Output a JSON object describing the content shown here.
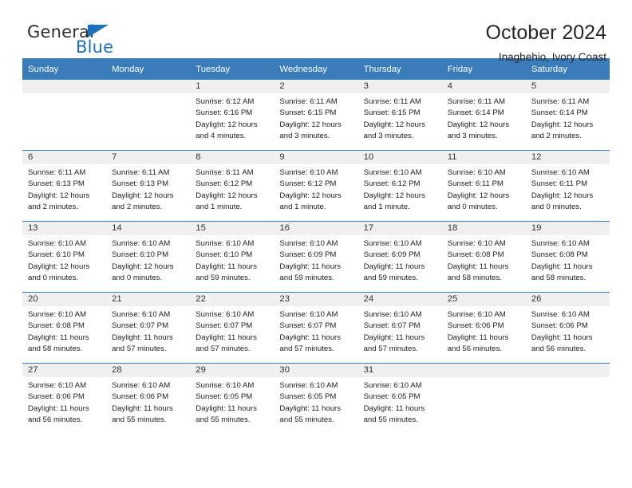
{
  "brand": {
    "name_part1": "General",
    "name_part2": "Blue",
    "logo_icon": "triangle-icon"
  },
  "header": {
    "title": "October 2024",
    "subtitle": "Inagbehio, Ivory Coast"
  },
  "calendar": {
    "weekday_headers": [
      "Sunday",
      "Monday",
      "Tuesday",
      "Wednesday",
      "Thursday",
      "Friday",
      "Saturday"
    ],
    "accent_color": "#3a7cb9",
    "daynum_bg": "#f0f0f0",
    "weeks": [
      [
        {
          "day": "",
          "lines": []
        },
        {
          "day": "",
          "lines": []
        },
        {
          "day": "1",
          "lines": [
            "Sunrise: 6:12 AM",
            "Sunset: 6:16 PM",
            "Daylight: 12 hours",
            "and 4 minutes."
          ]
        },
        {
          "day": "2",
          "lines": [
            "Sunrise: 6:11 AM",
            "Sunset: 6:15 PM",
            "Daylight: 12 hours",
            "and 3 minutes."
          ]
        },
        {
          "day": "3",
          "lines": [
            "Sunrise: 6:11 AM",
            "Sunset: 6:15 PM",
            "Daylight: 12 hours",
            "and 3 minutes."
          ]
        },
        {
          "day": "4",
          "lines": [
            "Sunrise: 6:11 AM",
            "Sunset: 6:14 PM",
            "Daylight: 12 hours",
            "and 3 minutes."
          ]
        },
        {
          "day": "5",
          "lines": [
            "Sunrise: 6:11 AM",
            "Sunset: 6:14 PM",
            "Daylight: 12 hours",
            "and 2 minutes."
          ]
        }
      ],
      [
        {
          "day": "6",
          "lines": [
            "Sunrise: 6:11 AM",
            "Sunset: 6:13 PM",
            "Daylight: 12 hours",
            "and 2 minutes."
          ]
        },
        {
          "day": "7",
          "lines": [
            "Sunrise: 6:11 AM",
            "Sunset: 6:13 PM",
            "Daylight: 12 hours",
            "and 2 minutes."
          ]
        },
        {
          "day": "8",
          "lines": [
            "Sunrise: 6:11 AM",
            "Sunset: 6:12 PM",
            "Daylight: 12 hours",
            "and 1 minute."
          ]
        },
        {
          "day": "9",
          "lines": [
            "Sunrise: 6:10 AM",
            "Sunset: 6:12 PM",
            "Daylight: 12 hours",
            "and 1 minute."
          ]
        },
        {
          "day": "10",
          "lines": [
            "Sunrise: 6:10 AM",
            "Sunset: 6:12 PM",
            "Daylight: 12 hours",
            "and 1 minute."
          ]
        },
        {
          "day": "11",
          "lines": [
            "Sunrise: 6:10 AM",
            "Sunset: 6:11 PM",
            "Daylight: 12 hours",
            "and 0 minutes."
          ]
        },
        {
          "day": "12",
          "lines": [
            "Sunrise: 6:10 AM",
            "Sunset: 6:11 PM",
            "Daylight: 12 hours",
            "and 0 minutes."
          ]
        }
      ],
      [
        {
          "day": "13",
          "lines": [
            "Sunrise: 6:10 AM",
            "Sunset: 6:10 PM",
            "Daylight: 12 hours",
            "and 0 minutes."
          ]
        },
        {
          "day": "14",
          "lines": [
            "Sunrise: 6:10 AM",
            "Sunset: 6:10 PM",
            "Daylight: 12 hours",
            "and 0 minutes."
          ]
        },
        {
          "day": "15",
          "lines": [
            "Sunrise: 6:10 AM",
            "Sunset: 6:10 PM",
            "Daylight: 11 hours",
            "and 59 minutes."
          ]
        },
        {
          "day": "16",
          "lines": [
            "Sunrise: 6:10 AM",
            "Sunset: 6:09 PM",
            "Daylight: 11 hours",
            "and 59 minutes."
          ]
        },
        {
          "day": "17",
          "lines": [
            "Sunrise: 6:10 AM",
            "Sunset: 6:09 PM",
            "Daylight: 11 hours",
            "and 59 minutes."
          ]
        },
        {
          "day": "18",
          "lines": [
            "Sunrise: 6:10 AM",
            "Sunset: 6:08 PM",
            "Daylight: 11 hours",
            "and 58 minutes."
          ]
        },
        {
          "day": "19",
          "lines": [
            "Sunrise: 6:10 AM",
            "Sunset: 6:08 PM",
            "Daylight: 11 hours",
            "and 58 minutes."
          ]
        }
      ],
      [
        {
          "day": "20",
          "lines": [
            "Sunrise: 6:10 AM",
            "Sunset: 6:08 PM",
            "Daylight: 11 hours",
            "and 58 minutes."
          ]
        },
        {
          "day": "21",
          "lines": [
            "Sunrise: 6:10 AM",
            "Sunset: 6:07 PM",
            "Daylight: 11 hours",
            "and 57 minutes."
          ]
        },
        {
          "day": "22",
          "lines": [
            "Sunrise: 6:10 AM",
            "Sunset: 6:07 PM",
            "Daylight: 11 hours",
            "and 57 minutes."
          ]
        },
        {
          "day": "23",
          "lines": [
            "Sunrise: 6:10 AM",
            "Sunset: 6:07 PM",
            "Daylight: 11 hours",
            "and 57 minutes."
          ]
        },
        {
          "day": "24",
          "lines": [
            "Sunrise: 6:10 AM",
            "Sunset: 6:07 PM",
            "Daylight: 11 hours",
            "and 57 minutes."
          ]
        },
        {
          "day": "25",
          "lines": [
            "Sunrise: 6:10 AM",
            "Sunset: 6:06 PM",
            "Daylight: 11 hours",
            "and 56 minutes."
          ]
        },
        {
          "day": "26",
          "lines": [
            "Sunrise: 6:10 AM",
            "Sunset: 6:06 PM",
            "Daylight: 11 hours",
            "and 56 minutes."
          ]
        }
      ],
      [
        {
          "day": "27",
          "lines": [
            "Sunrise: 6:10 AM",
            "Sunset: 6:06 PM",
            "Daylight: 11 hours",
            "and 56 minutes."
          ]
        },
        {
          "day": "28",
          "lines": [
            "Sunrise: 6:10 AM",
            "Sunset: 6:06 PM",
            "Daylight: 11 hours",
            "and 55 minutes."
          ]
        },
        {
          "day": "29",
          "lines": [
            "Sunrise: 6:10 AM",
            "Sunset: 6:05 PM",
            "Daylight: 11 hours",
            "and 55 minutes."
          ]
        },
        {
          "day": "30",
          "lines": [
            "Sunrise: 6:10 AM",
            "Sunset: 6:05 PM",
            "Daylight: 11 hours",
            "and 55 minutes."
          ]
        },
        {
          "day": "31",
          "lines": [
            "Sunrise: 6:10 AM",
            "Sunset: 6:05 PM",
            "Daylight: 11 hours",
            "and 55 minutes."
          ]
        },
        {
          "day": "",
          "lines": []
        },
        {
          "day": "",
          "lines": []
        }
      ]
    ]
  }
}
